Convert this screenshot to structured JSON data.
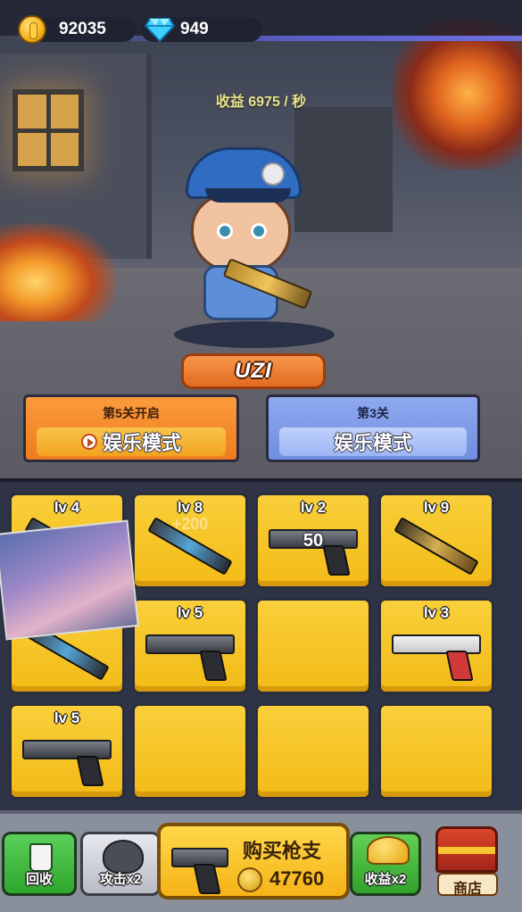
{
  "resources": {
    "coins": "92035",
    "gems": "949"
  },
  "income_text": "收益 6975 / 秒",
  "weapon_name": "UZI",
  "modes": {
    "left": {
      "subtitle": "第5关开启",
      "title": "娱乐模式"
    },
    "right": {
      "subtitle": "第3关",
      "title": "娱乐模式"
    }
  },
  "slots": [
    {
      "level": "lv 4",
      "weapon": "smg-icon",
      "note": ""
    },
    {
      "level": "lv 8",
      "weapon": "smg-icon",
      "note": "+200"
    },
    {
      "level": "lv 2",
      "weapon": "pistol-icon",
      "note": "50"
    },
    {
      "level": "lv 9",
      "weapon": "rifle-icon",
      "note": ""
    },
    {
      "level": "",
      "weapon": "smg-icon",
      "note": ""
    },
    {
      "level": "lv 5",
      "weapon": "pistol-icon",
      "note": ""
    },
    {
      "level": "",
      "weapon": "",
      "note": ""
    },
    {
      "level": "lv 3",
      "weapon": "pistol-icon",
      "note": ""
    },
    {
      "level": "lv 5",
      "weapon": "pistol-icon",
      "note": ""
    },
    {
      "level": "",
      "weapon": "",
      "note": ""
    },
    {
      "level": "",
      "weapon": "",
      "note": ""
    },
    {
      "level": "",
      "weapon": "",
      "note": ""
    }
  ],
  "bottom": {
    "delete_label": "回收",
    "attack_label": "攻击x2",
    "buy_title": "购买枪支",
    "buy_price": "47760",
    "income_label": "收益x2",
    "shop_label": "商店"
  },
  "colors": {
    "slot_yellow": "#f5c221",
    "mode_orange": "#f58a2e",
    "mode_blue": "#7f9de8",
    "plate_orange": "#ec7a2c"
  }
}
